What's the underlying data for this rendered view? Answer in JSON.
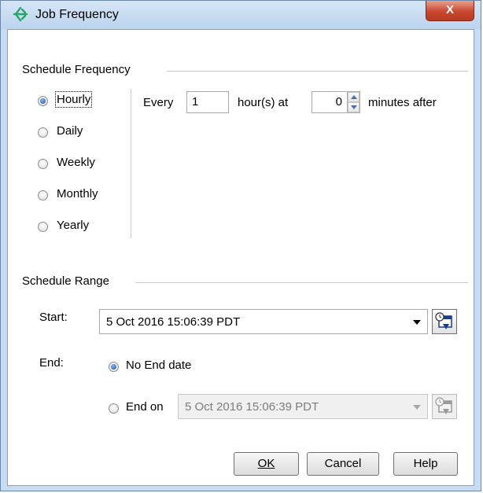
{
  "window": {
    "title": "Job Frequency",
    "close_symbol": "X",
    "icon": "job-scheduler-icon"
  },
  "schedule_frequency": {
    "title": "Schedule Frequency",
    "options": [
      {
        "label": "Hourly",
        "checked": true
      },
      {
        "label": "Daily",
        "checked": false
      },
      {
        "label": "Weekly",
        "checked": false
      },
      {
        "label": "Monthly",
        "checked": false
      },
      {
        "label": "Yearly",
        "checked": false
      }
    ],
    "hourly": {
      "every_label": "Every",
      "hours_value": "1",
      "hours_label": "hour(s) at",
      "minutes_value": "0",
      "minutes_label": "minutes after"
    }
  },
  "schedule_range": {
    "title": "Schedule Range",
    "start_label": "Start:",
    "start_value": "5 Oct 2016 15:06:39 PDT",
    "end_label": "End:",
    "no_end_label": "No End date",
    "no_end_checked": true,
    "end_on_label": "End on",
    "end_on_checked": false,
    "end_on_value": "5 Oct 2016 15:06:39 PDT"
  },
  "buttons": {
    "ok": "OK",
    "cancel": "Cancel",
    "help": "Help"
  },
  "colors": {
    "title_bar": "#c7dcf2",
    "close_button": "#c9472e",
    "radio_selected": "#1d4f9a",
    "disabled_text": "#7d7d7d"
  }
}
